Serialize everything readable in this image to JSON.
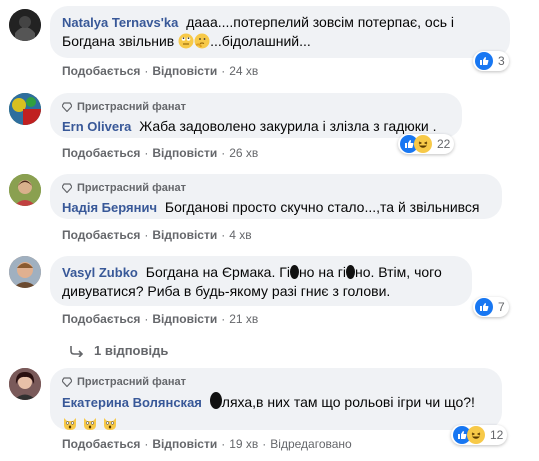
{
  "comments": [
    {
      "author": "Natalya Ternavs'ka",
      "badge": "",
      "text_parts": [
        "дааа....потерпелий зовсім потерпає, ось і Богдана звільнив",
        "...бідолашний..."
      ],
      "like": "Подобається",
      "reply": "Відповісти",
      "time": "24 хв",
      "reactions": "3"
    },
    {
      "author": "Ern Olivera",
      "badge": "Пристрасний фанат",
      "text": "Жаба задоволено закурила і злізла з гадюки .",
      "like": "Подобається",
      "reply": "Відповісти",
      "time": "26 хв",
      "reactions": "22"
    },
    {
      "author": "Надія Берянич",
      "badge": "Пристрасний фанат",
      "text": "Богданові просто скучно стало...,та й звільнився",
      "like": "Подобається",
      "reply": "Відповісти",
      "time": "4 хв"
    },
    {
      "author": "Vasyl Zubko",
      "badge": "",
      "text_parts": [
        "Богдана на Єрмака. Гі",
        "но на гі",
        "но. Втім, чого дивуватися? Риба в будь-якому разі гниє з голови."
      ],
      "like": "Подобається",
      "reply": "Відповісти",
      "time": "21 хв",
      "reactions": "7"
    },
    {
      "author": "Екатерина Волянская",
      "badge": "Пристрасний фанат",
      "text": "ляха,в них там що рольові ігри чи що?!",
      "like": "Подобається",
      "reply": "Відповісти",
      "time": "19 хв",
      "edited": "Відредаговано",
      "reactions": "12"
    }
  ],
  "replies_link": "1 відповідь",
  "colors": {
    "link": "#385898",
    "bubble": "#f0f2f5",
    "meta": "#65676b",
    "like_blue": "#1877f2"
  }
}
